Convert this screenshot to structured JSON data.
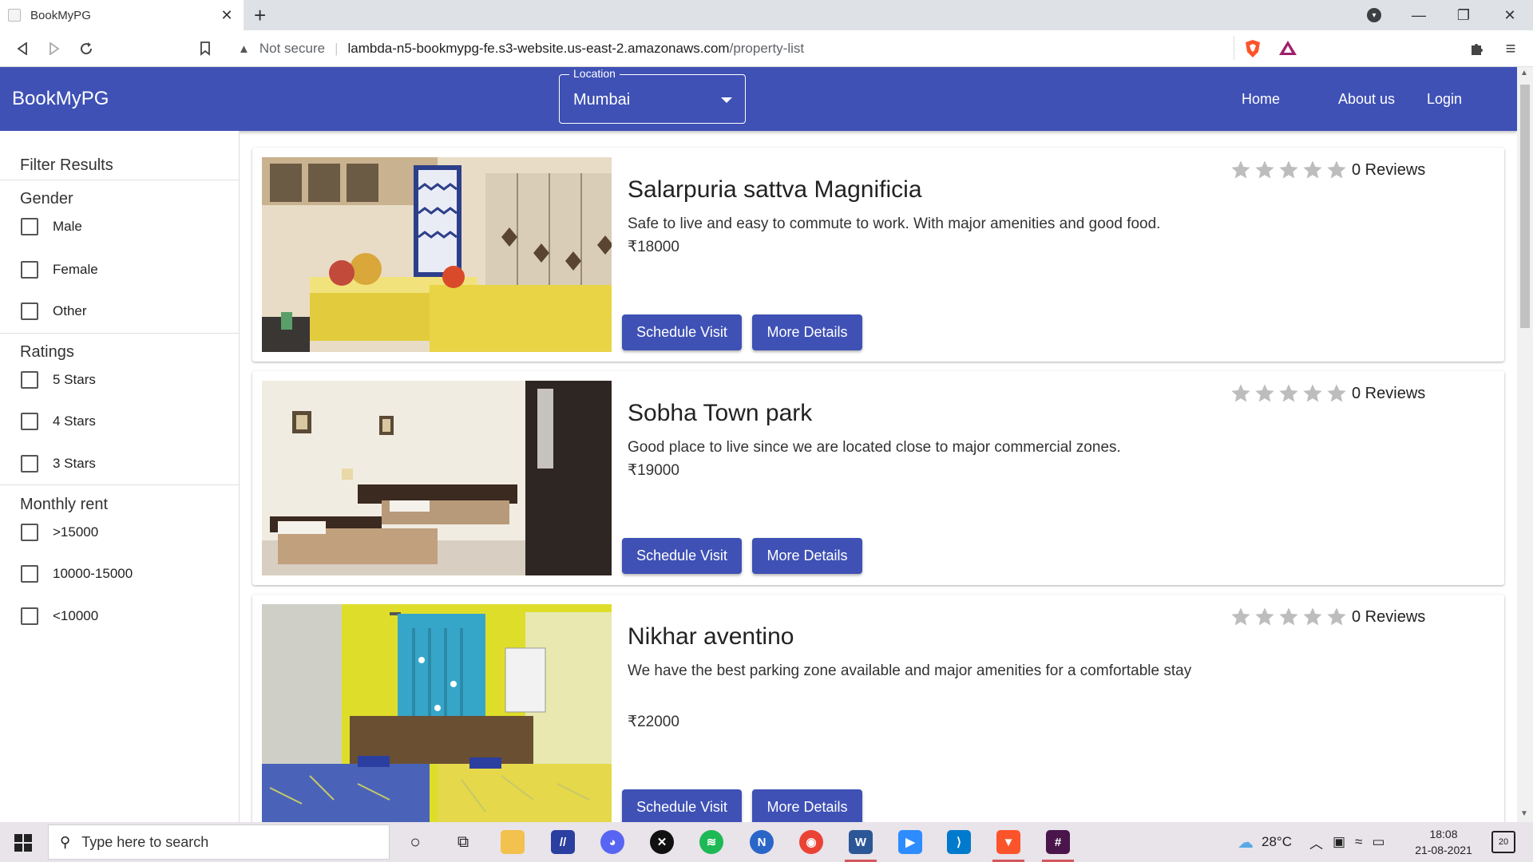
{
  "browser": {
    "tab_title": "BookMyPG",
    "tab_close": "✕",
    "new_tab": "+",
    "url_warning": "Not secure",
    "url_host": "lambda-n5-bookmypg-fe.s3-website.us-east-2.amazonaws.com",
    "url_path": "/property-list"
  },
  "header": {
    "brand": "BookMyPG",
    "location_label": "Location",
    "location_value": "Mumbai",
    "nav": {
      "home": "Home",
      "about": "About us",
      "login": "Login"
    }
  },
  "sidebar": {
    "title": "Filter Results",
    "gender": {
      "title": "Gender",
      "options": [
        "Male",
        "Female",
        "Other"
      ]
    },
    "ratings": {
      "title": "Ratings",
      "options": [
        "5 Stars",
        "4 Stars",
        "3 Stars"
      ]
    },
    "rent": {
      "title": "Monthly rent",
      "options": [
        ">15000",
        "10000-15000",
        "<10000"
      ]
    }
  },
  "listings": [
    {
      "name": "Salarpuria sattva Magnificia",
      "description": "Safe to live and easy to commute to work. With major amenities and good food.",
      "price": "₹18000",
      "reviews": "0 Reviews",
      "rating": 0
    },
    {
      "name": "Sobha Town park",
      "description": "Good place to live since we are located close to major commercial zones.",
      "price": "₹19000",
      "reviews": "0 Reviews",
      "rating": 0
    },
    {
      "name": "Nikhar aventino",
      "description": "We have the best parking zone available and major amenities for a comfortable stay",
      "price": "₹22000",
      "reviews": "0 Reviews",
      "rating": 0
    }
  ],
  "buttons": {
    "schedule": "Schedule Visit",
    "details": "More Details"
  },
  "taskbar": {
    "search_placeholder": "Type here to search",
    "weather": "28°C",
    "time": "18:08",
    "date": "21-08-2021",
    "notification_count": "20"
  },
  "colors": {
    "primary": "#3f51b5",
    "star": "#bdbdbd"
  }
}
